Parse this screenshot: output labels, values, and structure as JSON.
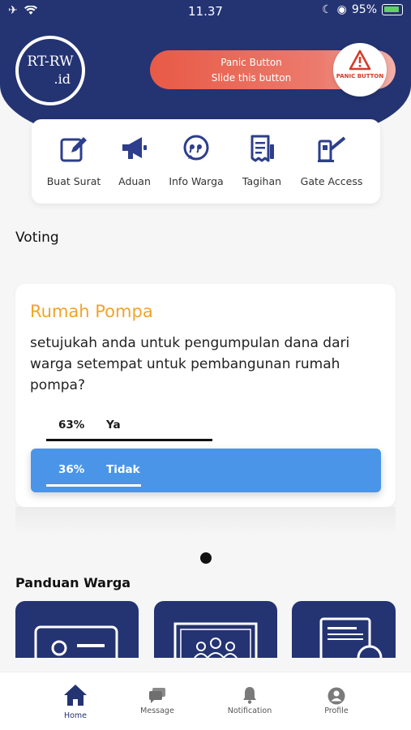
{
  "status_bar": {
    "time": "11.37",
    "battery": "95%"
  },
  "logo": {
    "line1": "RT-RW",
    "line2": ".id"
  },
  "panic": {
    "title": "Panic Button",
    "subtitle": "Slide this button",
    "knob_label": "PANIC BUTTON",
    "color": "#e85a46"
  },
  "menu": {
    "items": [
      {
        "label": "Buat Surat",
        "icon": "edit-icon"
      },
      {
        "label": "Aduan",
        "icon": "megaphone-icon"
      },
      {
        "label": "Info Warga",
        "icon": "chat-quote-icon"
      },
      {
        "label": "Tagihan",
        "icon": "receipt-icon"
      },
      {
        "label": "Gate Access",
        "icon": "gate-icon"
      }
    ]
  },
  "voting": {
    "section_title": "Voting",
    "card": {
      "title": "Rumah Pompa",
      "question": "setujukah anda untuk pengumpulan dana dari warga setempat untuk pembangunan rumah pompa?",
      "options": [
        {
          "percent": "63%",
          "label": "Ya",
          "value": 0.63
        },
        {
          "percent": "36%",
          "label": "Tidak",
          "value": 0.36,
          "selected": true
        }
      ]
    }
  },
  "panduan": {
    "section_title": "Panduan Warga"
  },
  "bottom_nav": {
    "items": [
      {
        "label": "Home",
        "icon": "home-icon",
        "active": true
      },
      {
        "label": "Message",
        "icon": "message-icon"
      },
      {
        "label": "Notification",
        "icon": "bell-icon"
      },
      {
        "label": "Profile",
        "icon": "user-icon"
      }
    ]
  },
  "colors": {
    "navy": "#243372",
    "accent_blue": "#4a95e8",
    "title_orange": "#f2a32b"
  }
}
